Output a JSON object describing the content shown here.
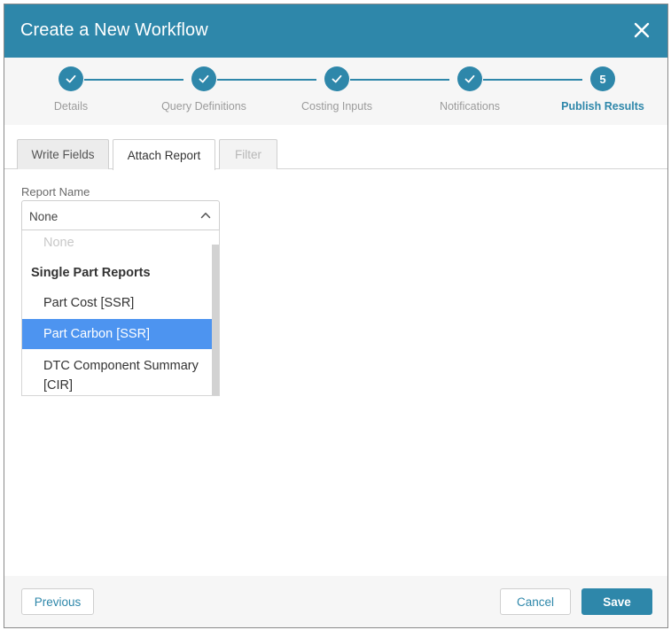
{
  "dialog": {
    "title": "Create a New Workflow",
    "close_icon": "close-icon"
  },
  "stepper": {
    "steps": [
      {
        "label": "Details",
        "state": "complete",
        "marker": "check-icon"
      },
      {
        "label": "Query Definitions",
        "state": "complete",
        "marker": "check-icon"
      },
      {
        "label": "Costing Inputs",
        "state": "complete",
        "marker": "check-icon"
      },
      {
        "label": "Notifications",
        "state": "complete",
        "marker": "check-icon"
      },
      {
        "label": "Publish Results",
        "state": "active",
        "number": "5"
      }
    ]
  },
  "tabs": [
    {
      "label": "Write Fields",
      "state": "inactive"
    },
    {
      "label": "Attach Report",
      "state": "selected"
    },
    {
      "label": "Filter",
      "state": "disabled"
    }
  ],
  "report": {
    "label": "Report Name",
    "selected_value": "None",
    "options": {
      "none": "None",
      "group_label": "Single Part Reports",
      "items": [
        {
          "label": "Part Cost [SSR]",
          "highlighted": false
        },
        {
          "label": "Part Carbon [SSR]",
          "highlighted": true
        },
        {
          "label": "DTC Component Summary [CIR]",
          "highlighted": false
        }
      ]
    }
  },
  "footer": {
    "previous_label": "Previous",
    "cancel_label": "Cancel",
    "save_label": "Save"
  },
  "colors": {
    "accent": "#2e87aa",
    "highlight": "#4d94f0"
  }
}
